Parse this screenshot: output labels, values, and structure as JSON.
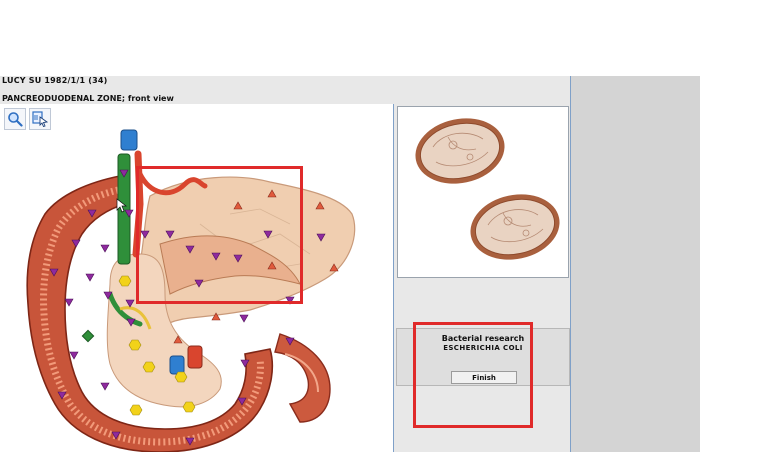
{
  "header": {
    "patient_line": "LUCY  SU   1982/1/1 (34)",
    "zone_title": "PANCREODUODENAL ZONE; front view"
  },
  "toolbar": {
    "zoom_icon": "magnifier-icon",
    "select_icon": "select-cursor-icon"
  },
  "info_panel": {
    "title": "Bacterial research",
    "organism": "ESCHERICHIA  COLI",
    "finish_label": "Finish"
  },
  "colors": {
    "highlight": "#e02a2a",
    "marker_purple": "#8e2a9e",
    "marker_red": "#d9452e",
    "marker_yellow": "#f2d21a",
    "tissue": "#c8553a",
    "pancreas": "#f0ceb0"
  }
}
